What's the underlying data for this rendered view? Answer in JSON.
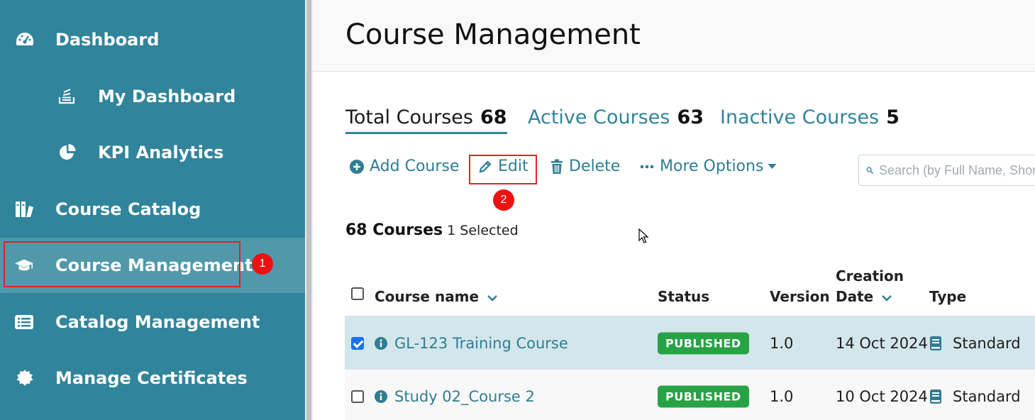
{
  "sidebar": {
    "items": [
      {
        "label": "Dashboard",
        "icon": "gauge-icon"
      },
      {
        "label": "My Dashboard",
        "icon": "stack-icon"
      },
      {
        "label": "KPI Analytics",
        "icon": "pie-chart-icon"
      },
      {
        "label": "Course Catalog",
        "icon": "catalog-icon"
      },
      {
        "label": "Course Management",
        "icon": "graduation-cap-icon"
      },
      {
        "label": "Catalog Management",
        "icon": "list-icon"
      },
      {
        "label": "Manage Certificates",
        "icon": "certificate-icon"
      }
    ],
    "accent": "#30849b",
    "active_bg": "#5198ab"
  },
  "markers": {
    "one": "1",
    "two": "2"
  },
  "page": {
    "title": "Course Management"
  },
  "tabs": [
    {
      "label": "Total Courses",
      "count": "68"
    },
    {
      "label": "Active Courses",
      "count": "63"
    },
    {
      "label": "Inactive Courses",
      "count": "5"
    }
  ],
  "toolbar": {
    "add_label": "Add Course",
    "edit_label": "Edit",
    "delete_label": "Delete",
    "more_label": "More Options",
    "search_placeholder": "Search (by Full Name, Short"
  },
  "summary": {
    "count": "68 Courses",
    "selected": "1 Selected"
  },
  "table": {
    "headers": {
      "name": "Course name",
      "status": "Status",
      "version": "Version",
      "date_line1": "Creation",
      "date_line2": "Date",
      "type": "Type"
    },
    "rows": [
      {
        "name": "GL-123 Training Course",
        "status": "PUBLISHED",
        "version": "1.0",
        "date": "14 Oct 2024",
        "type": "Standard",
        "checked": true
      },
      {
        "name": "Study 02_Course 2",
        "status": "PUBLISHED",
        "version": "1.0",
        "date": "10 Oct 2024",
        "type": "Standard",
        "checked": false
      }
    ]
  },
  "colors": {
    "published": "#27a245",
    "link": "#2f7d93",
    "annotation": "#e02424"
  }
}
